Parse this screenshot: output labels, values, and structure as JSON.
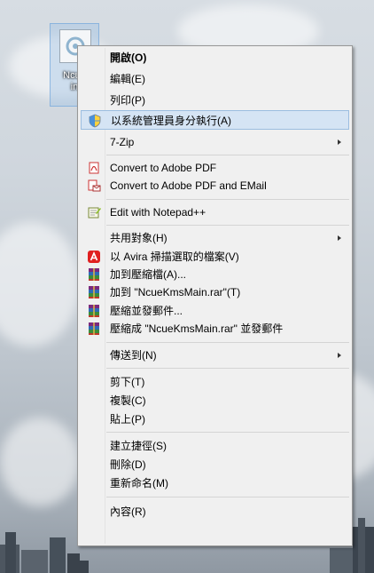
{
  "desktop_icon": {
    "label_line1": "Ncue",
    "label_line2": "in"
  },
  "menu": {
    "items": [
      {
        "label": "開啟(O)",
        "bold": true
      },
      {
        "label": "編輯(E)"
      },
      {
        "label": "列印(P)"
      },
      {
        "label": "以系統管理員身分執行(A)",
        "icon": "shield-icon",
        "highlighted": true
      },
      {
        "label": "7-Zip",
        "submenu": true
      },
      {
        "label": "Convert to Adobe PDF",
        "icon": "adobe-pdf-icon"
      },
      {
        "label": "Convert to Adobe PDF and EMail",
        "icon": "adobe-pdf-email-icon"
      },
      {
        "label": "Edit with Notepad++",
        "icon": "notepad-plus-plus-icon"
      },
      {
        "label": "共用對象(H)",
        "submenu": true
      },
      {
        "label": "以 Avira 掃描選取的檔案(V)",
        "icon": "avira-icon"
      },
      {
        "label": "加到壓縮檔(A)...",
        "icon": "winrar-icon"
      },
      {
        "label": "加到 \"NcueKmsMain.rar\"(T)",
        "icon": "winrar-icon"
      },
      {
        "label": "壓縮並發郵件...",
        "icon": "winrar-icon"
      },
      {
        "label": "壓縮成 \"NcueKmsMain.rar\" 並發郵件",
        "icon": "winrar-icon"
      },
      {
        "label": "傳送到(N)",
        "submenu": true
      },
      {
        "label": "剪下(T)"
      },
      {
        "label": "複製(C)"
      },
      {
        "label": "貼上(P)"
      },
      {
        "label": "建立捷徑(S)"
      },
      {
        "label": "刪除(D)"
      },
      {
        "label": "重新命名(M)"
      },
      {
        "label": "內容(R)"
      }
    ]
  }
}
